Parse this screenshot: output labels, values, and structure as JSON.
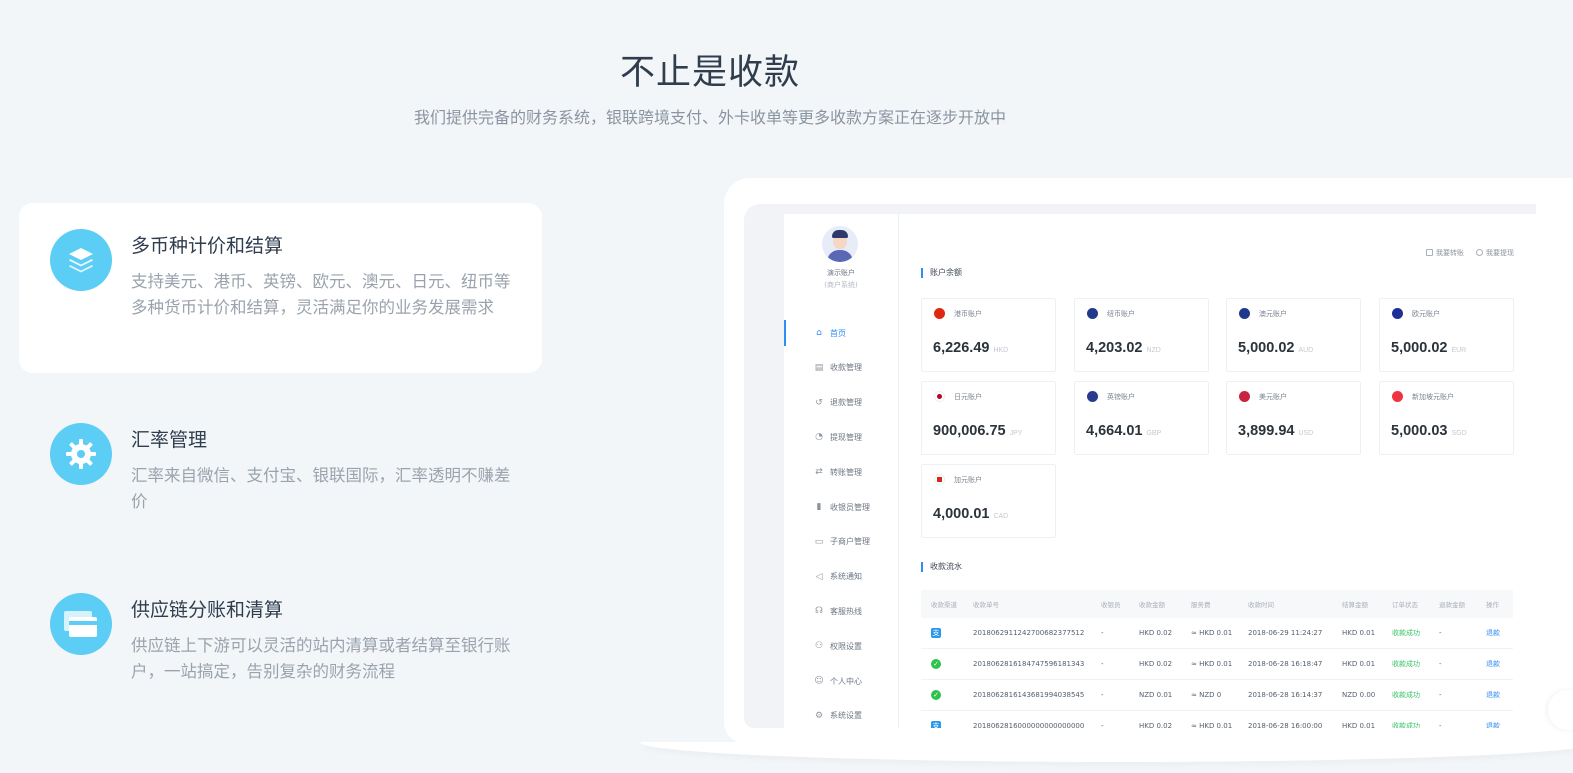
{
  "hero": {
    "title": "不止是收款",
    "subtitle": "我们提供完备的财务系统，银联跨境支付、外卡收单等更多收款方案正在逐步开放中"
  },
  "features": [
    {
      "title": "多币种计价和结算",
      "desc": "支持美元、港币、英镑、欧元、澳元、日元、纽币等多种货币计价和结算，灵活满足你的业务发展需求",
      "icon": "layers-icon"
    },
    {
      "title": "汇率管理",
      "desc": "汇率来自微信、支付宝、银联国际，汇率透明不赚差价",
      "icon": "gear-icon"
    },
    {
      "title": "供应链分账和清算",
      "desc": "供应链上下游可以灵活的站内清算或者结算至银行账户，一站搞定，告别复杂的财务流程",
      "icon": "cards-icon"
    }
  ],
  "dashboard": {
    "user": {
      "name": "演示账户",
      "role": "(商户系统)"
    },
    "nav": [
      {
        "label": "首页",
        "icon": "home-icon",
        "glyph": "⌂"
      },
      {
        "label": "收款管理",
        "icon": "receipt-icon",
        "glyph": "▤"
      },
      {
        "label": "退款管理",
        "icon": "refund-icon",
        "glyph": "↺"
      },
      {
        "label": "提现管理",
        "icon": "withdraw-icon",
        "glyph": "◔"
      },
      {
        "label": "转账管理",
        "icon": "transfer-icon",
        "glyph": "⇄"
      },
      {
        "label": "收银员管理",
        "icon": "cashier-icon",
        "glyph": "▮"
      },
      {
        "label": "子商户管理",
        "icon": "sub-merchant-icon",
        "glyph": "▭"
      },
      {
        "label": "系统通知",
        "icon": "speaker-icon",
        "glyph": "◁"
      },
      {
        "label": "客服热线",
        "icon": "headset-icon",
        "glyph": "☊"
      },
      {
        "label": "权限设置",
        "icon": "permission-icon",
        "glyph": "⚇"
      },
      {
        "label": "个人中心",
        "icon": "user-icon",
        "glyph": "☺"
      },
      {
        "label": "系统设置",
        "icon": "settings-icon",
        "glyph": "⚙"
      }
    ],
    "top_links": [
      "我要转账",
      "我要提现"
    ],
    "balance_title": "账户余额",
    "accounts": [
      {
        "name": "港币账户",
        "amount": "6,226.49",
        "currency": "HKD",
        "flag_color": "#de2910"
      },
      {
        "name": "纽币账户",
        "amount": "4,203.02",
        "currency": "NZD",
        "flag_color": "#1f3a8a"
      },
      {
        "name": "澳元账户",
        "amount": "5,000.02",
        "currency": "AUD",
        "flag_color": "#1f3a8a"
      },
      {
        "name": "欧元账户",
        "amount": "5,000.02",
        "currency": "EUR",
        "flag_color": "#1e2f97"
      },
      {
        "name": "日元账户",
        "amount": "900,006.75",
        "currency": "JPY",
        "flag_color": "#ffffff"
      },
      {
        "name": "英镑账户",
        "amount": "4,664.01",
        "currency": "GBP",
        "flag_color": "#2a3b8f"
      },
      {
        "name": "美元账户",
        "amount": "3,899.94",
        "currency": "USD",
        "flag_color": "#c9243f"
      },
      {
        "name": "新加坡元账户",
        "amount": "5,000.03",
        "currency": "SGD",
        "flag_color": "#ef3340"
      },
      {
        "name": "加元账户",
        "amount": "4,000.01",
        "currency": "CAD",
        "flag_color": "#ffffff"
      }
    ],
    "flow_title": "收款流水",
    "table": {
      "headers": [
        "收款渠道",
        "收款单号",
        "收银员",
        "收款金额",
        "服务费",
        "收款时间",
        "结算金额",
        "订单状态",
        "退款金额",
        "操作"
      ],
      "rows": [
        {
          "channel": "alipay-icon",
          "channel_glyph": "支",
          "cells": [
            "20180629112427006823775​12",
            "-",
            "HKD 0.02",
            "≈ HKD 0.01",
            "2018-06-29 11:24:27",
            "HKD 0.01",
            "收款成功",
            "-",
            "退款"
          ]
        },
        {
          "channel": "wechat-icon",
          "channel_glyph": "✓",
          "cells": [
            "201806281618474759618​1343",
            "-",
            "HKD 0.02",
            "≈ HKD 0.01",
            "2018-06-28 16:18:47",
            "HKD 0.01",
            "收款成功",
            "-",
            "退款"
          ]
        },
        {
          "channel": "wechat-icon",
          "channel_glyph": "✓",
          "cells": [
            "201806281614368199403​8545",
            "-",
            "NZD 0.01",
            "≈ NZD 0",
            "2018-06-28 16:14:37",
            "NZD 0.00",
            "收款成功",
            "-",
            "退款"
          ]
        },
        {
          "channel": "alipay-icon",
          "channel_glyph": "支",
          "cells": [
            "201806281600000000000​0000",
            "-",
            "HKD 0.02",
            "≈ HKD 0.01",
            "2018-06-28 16:00:00",
            "HKD 0.01",
            "收款成功",
            "-",
            "退款"
          ]
        }
      ]
    }
  }
}
